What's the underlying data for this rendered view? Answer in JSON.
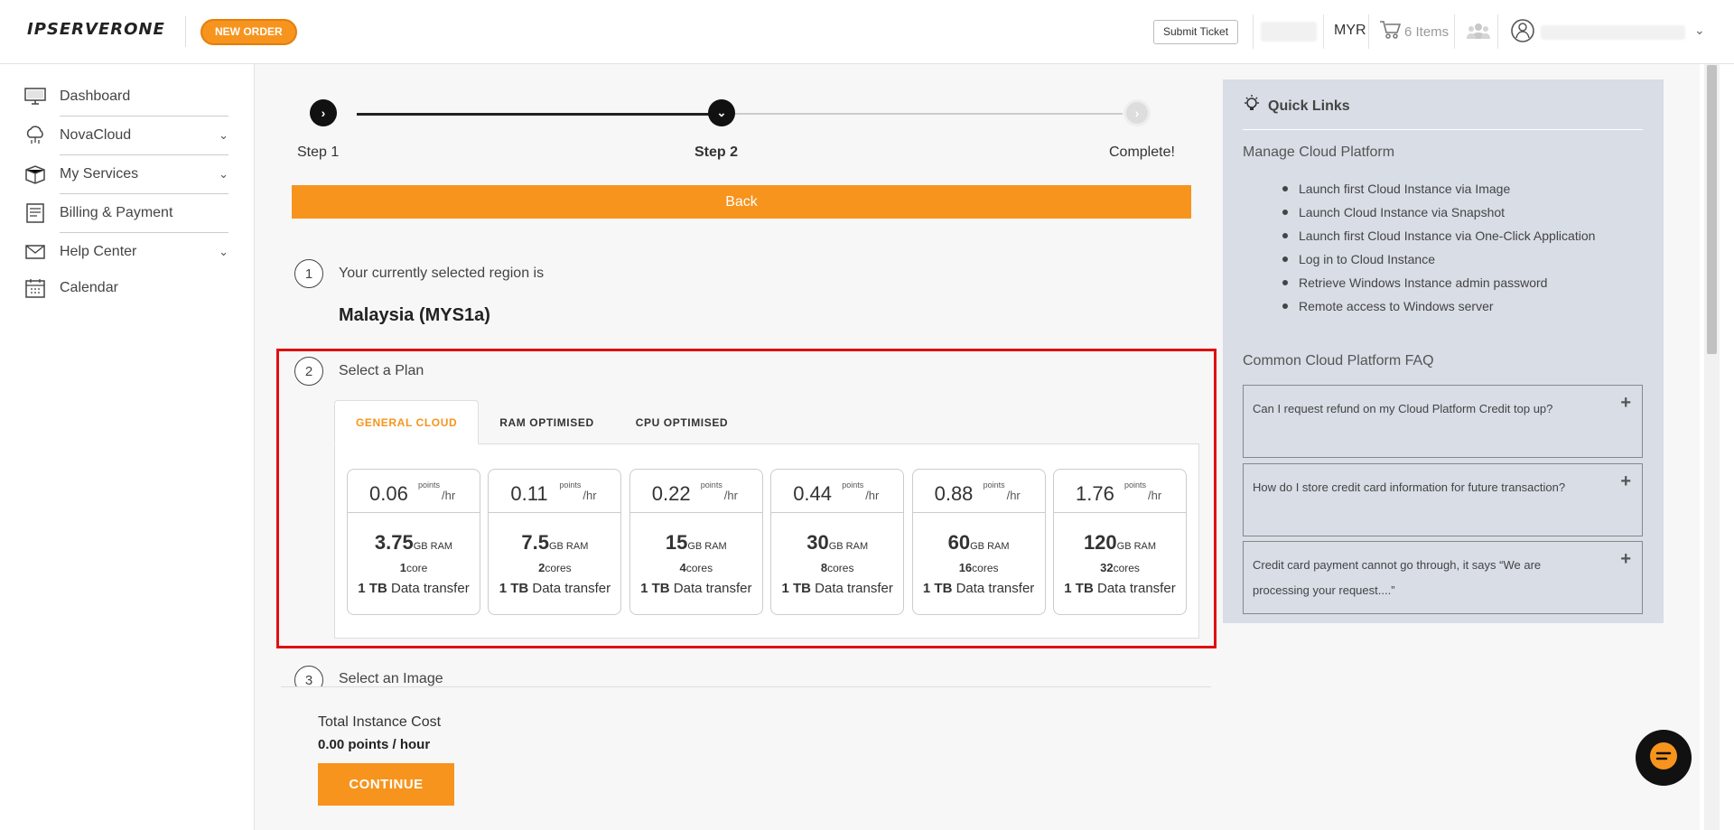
{
  "header": {
    "logo": "IPSERVERONE",
    "new_order": "NEW ORDER",
    "submit_ticket": "Submit Ticket",
    "currency": "MYR",
    "cart_label": "6 Items"
  },
  "sidebar": {
    "items": [
      {
        "label": "Dashboard",
        "icon": "monitor-icon",
        "has_children": false
      },
      {
        "label": "NovaCloud",
        "icon": "cloud-icon",
        "has_children": true
      },
      {
        "label": "My Services",
        "icon": "box-icon",
        "has_children": true
      },
      {
        "label": "Billing & Payment",
        "icon": "billing-icon",
        "has_children": false
      },
      {
        "label": "Help Center",
        "icon": "envelope-icon",
        "has_children": true
      },
      {
        "label": "Calendar",
        "icon": "calendar-icon",
        "has_children": false
      }
    ]
  },
  "stepper": {
    "steps": [
      {
        "label": "Step 1",
        "state": "done"
      },
      {
        "label": "Step 2",
        "state": "current"
      },
      {
        "label": "Complete!",
        "state": "todo"
      }
    ],
    "back_label": "Back"
  },
  "section1": {
    "number": "1",
    "title": "Your currently selected region is",
    "region": "Malaysia (MYS1a)"
  },
  "section2": {
    "number": "2",
    "title": "Select a Plan",
    "tabs": [
      "GENERAL CLOUD",
      "RAM OPTIMISED",
      "CPU OPTIMISED"
    ],
    "active_tab": "GENERAL CLOUD",
    "points_label": "points",
    "per_hr_label": "/hr",
    "ram_unit": "GB RAM",
    "transfer_amount": "1 TB",
    "transfer_label": "Data transfer",
    "plans": [
      {
        "price": "0.06",
        "ram": "3.75",
        "cores_num": "1",
        "cores_unit": "core"
      },
      {
        "price": "0.11",
        "ram": "7.5",
        "cores_num": "2",
        "cores_unit": "cores"
      },
      {
        "price": "0.22",
        "ram": "15",
        "cores_num": "4",
        "cores_unit": "cores"
      },
      {
        "price": "0.44",
        "ram": "30",
        "cores_num": "8",
        "cores_unit": "cores"
      },
      {
        "price": "0.88",
        "ram": "60",
        "cores_num": "16",
        "cores_unit": "cores"
      },
      {
        "price": "1.76",
        "ram": "120",
        "cores_num": "32",
        "cores_unit": "cores"
      }
    ]
  },
  "section3": {
    "number": "3",
    "title": "Select an Image"
  },
  "cost": {
    "label": "Total Instance Cost",
    "value": "0.00 points / hour",
    "continue_label": "CONTINUE"
  },
  "quick_links": {
    "title": "Quick Links",
    "manage_title": "Manage Cloud Platform",
    "links": [
      "Launch first Cloud Instance via Image",
      "Launch Cloud Instance via Snapshot",
      "Launch first Cloud Instance via One-Click Application",
      "Log in to Cloud Instance",
      "Retrieve Windows Instance admin password",
      "Remote access to Windows server"
    ],
    "faq_title": "Common Cloud Platform FAQ",
    "faqs": [
      "Can I request refund on my Cloud Platform Credit top up?",
      "How do I store credit card information for future transaction?",
      "Credit card payment cannot go through, it says “We are processing your request....”"
    ]
  },
  "colors": {
    "accent": "#f7941d",
    "highlight": "#e01010",
    "panel": "#d8dde6"
  }
}
